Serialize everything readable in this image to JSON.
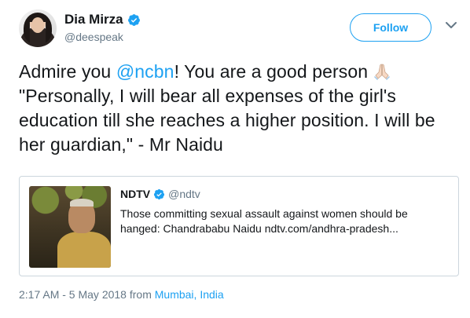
{
  "user": {
    "display_name": "Dia Mirza",
    "handle": "@deespeak"
  },
  "follow_button": {
    "label": "Follow"
  },
  "tweet": {
    "text_before": "Admire you ",
    "mention": "@ncbn",
    "text_after": "! You are a good person ",
    "text_quote": " \"Personally, I will bear all expenses of the girl's education till she reaches a higher position. I will be her guardian,\" - Mr Naidu"
  },
  "quoted_tweet": {
    "name": "NDTV",
    "handle": "@ndtv",
    "text": "Those committing sexual assault against women should be hanged: Chandrababu Naidu ndtv.com/andhra-pradesh..."
  },
  "meta": {
    "timestamp": "2:17 AM - 5 May 2018",
    "from_label": " from ",
    "location": "Mumbai, India"
  },
  "colors": {
    "accent": "#1da1f2",
    "secondary_text": "#657786",
    "border": "#ccd6dd"
  },
  "icons": [
    "verified-icon",
    "chevron-down-icon",
    "folded-hands-icon"
  ]
}
